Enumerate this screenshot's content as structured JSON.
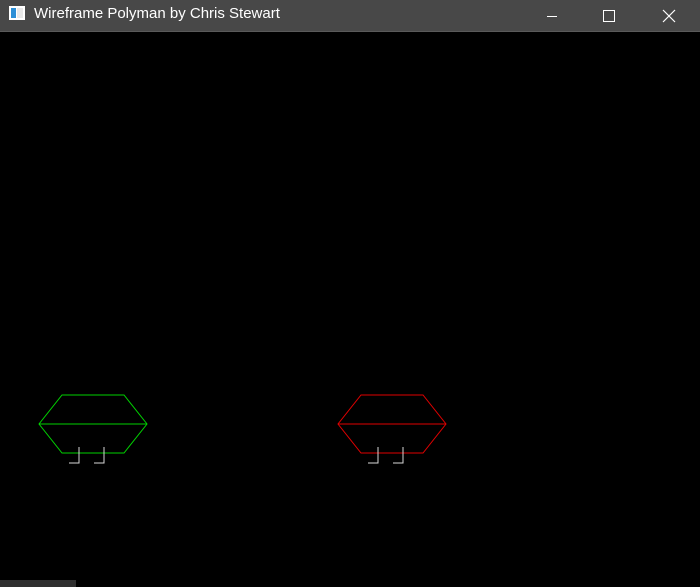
{
  "window": {
    "title": "Wireframe Polyman by Chris Stewart",
    "controls": {
      "minimize_icon": "minimize-icon",
      "maximize_icon": "maximize-icon",
      "close_icon": "close-icon"
    }
  },
  "scene": {
    "background_color": "#000000",
    "player": {
      "color": "#00d200",
      "legs_color": "#d8d8d8"
    },
    "enemy": {
      "color": "#e00000",
      "legs_color": "#d8d8d8"
    }
  }
}
